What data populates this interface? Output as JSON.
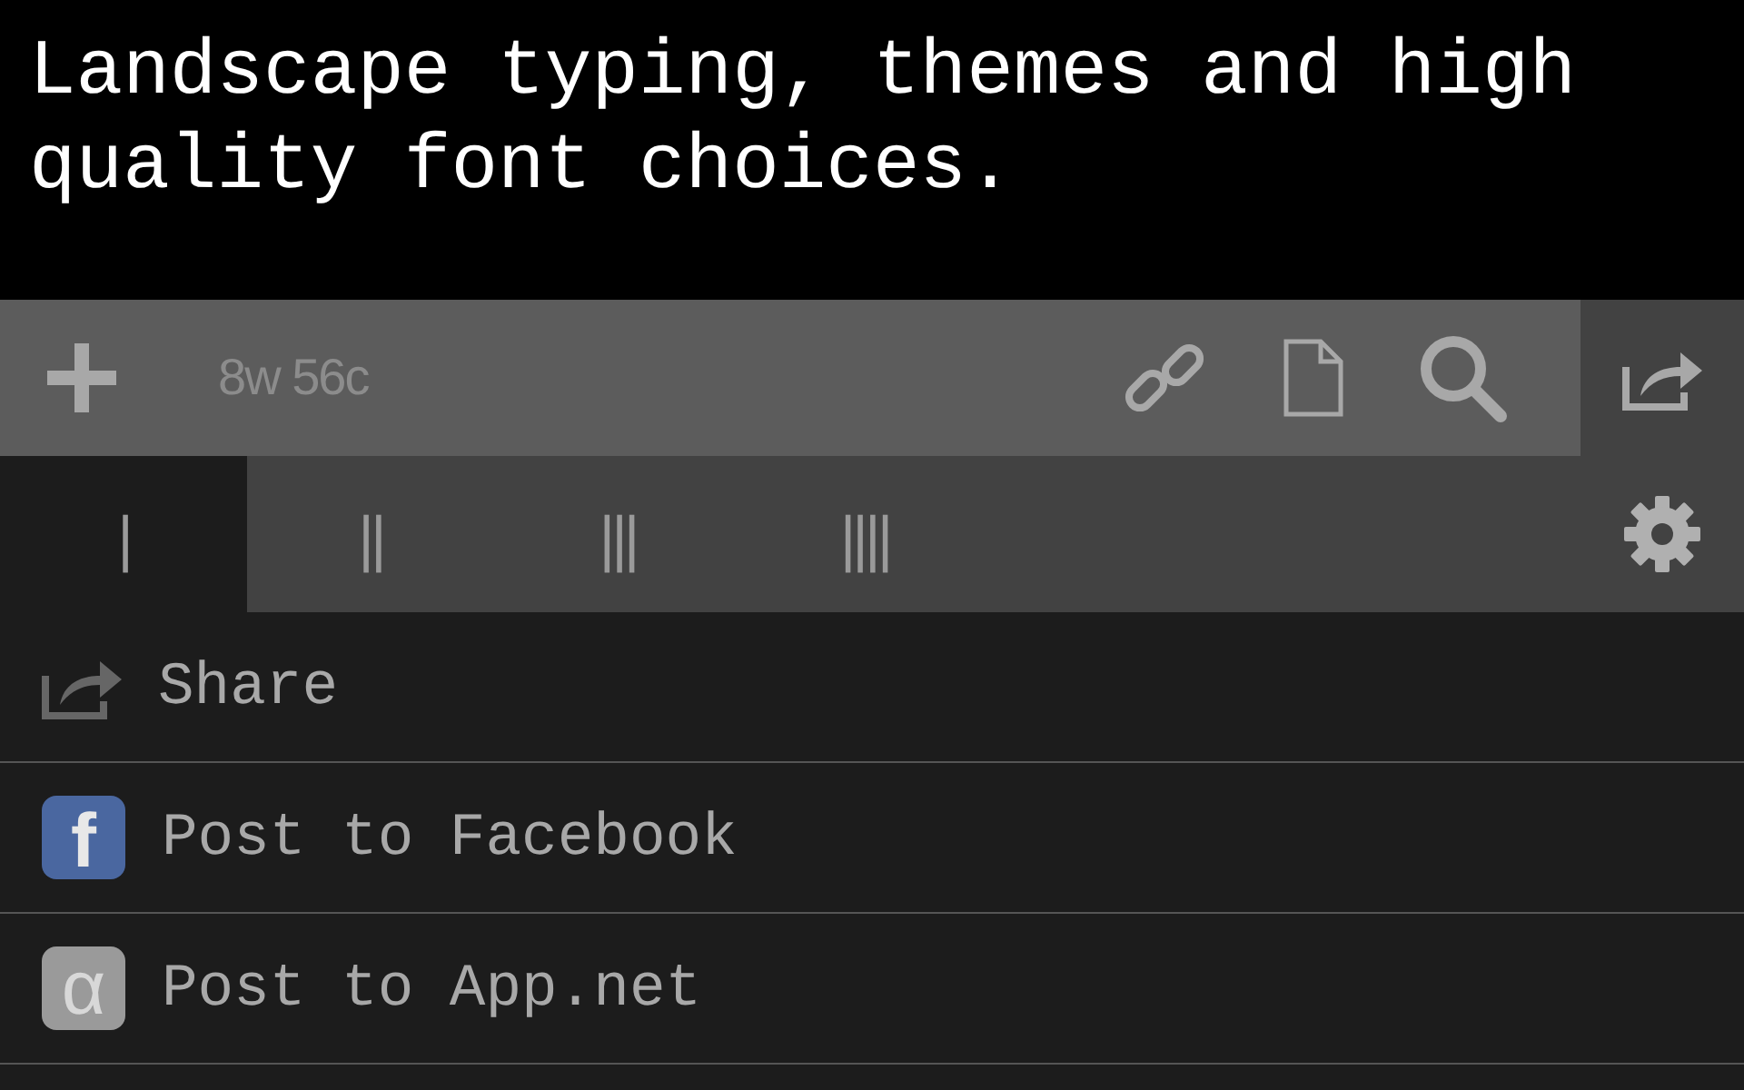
{
  "editor": {
    "text": "Landscape typing, themes and high quality font choices."
  },
  "toolbar": {
    "word_count": "8w 56c"
  },
  "tabs": [
    {
      "label": "|",
      "selected": true
    },
    {
      "label": "||",
      "selected": false
    },
    {
      "label": "|||",
      "selected": false
    },
    {
      "label": "||||",
      "selected": false
    }
  ],
  "menu": [
    {
      "kind": "share",
      "label": "Share"
    },
    {
      "kind": "facebook",
      "glyph": "f",
      "label": "Post to Facebook"
    },
    {
      "kind": "appnet",
      "glyph": "α",
      "label": "Post to App.net"
    }
  ]
}
